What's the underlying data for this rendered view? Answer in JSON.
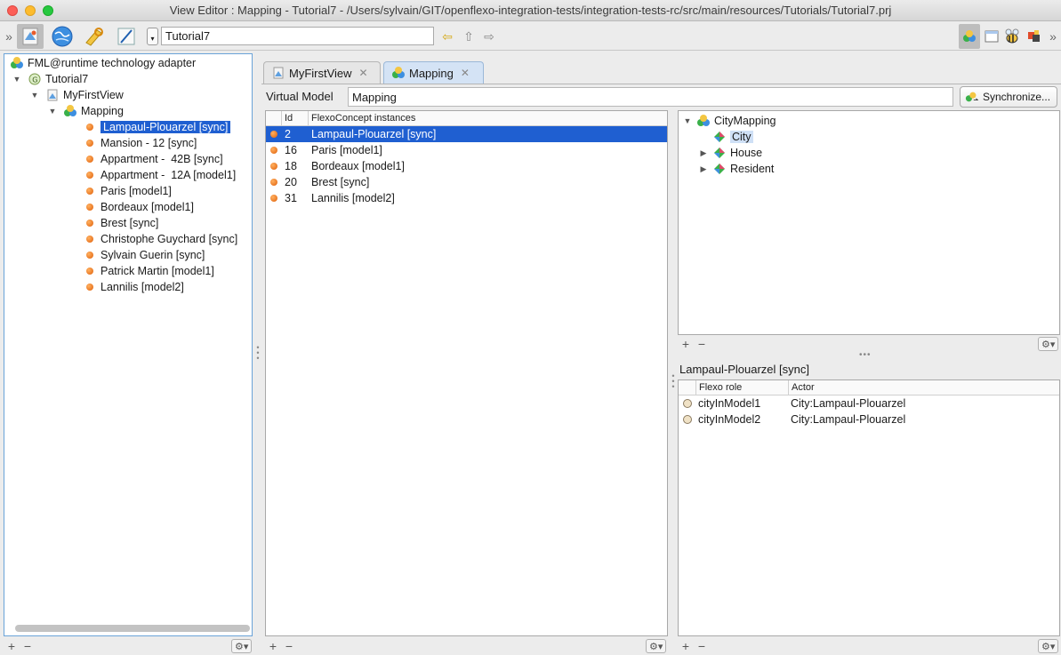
{
  "window": {
    "title": "View Editor : Mapping - Tutorial7 - /Users/sylvain/GIT/openflexo-integration-tests/integration-tests-rc/src/main/resources/Tutorials/Tutorial7.prj"
  },
  "toolbar": {
    "project_field": "Tutorial7",
    "icons": [
      "collapse-icon",
      "view-editor-icon",
      "globe-icon",
      "tools-icon",
      "pen-icon",
      "back-arrow-icon",
      "up-arrow-icon",
      "forward-arrow-icon",
      "modules-icon",
      "window-icon",
      "bee-icon",
      "flag-icon"
    ]
  },
  "left_tree": {
    "root": "FML@runtime technology adapter",
    "project": "Tutorial7",
    "view": "MyFirstView",
    "mapping": "Mapping",
    "instances": [
      "Lampaul-Plouarzel [sync]",
      "Mansion - 12 [sync]",
      "Appartment -  42B [sync]",
      "Appartment -  12A [model1]",
      "Paris [model1]",
      "Bordeaux [model1]",
      "Brest [sync]",
      "Christophe Guychard [sync]",
      "Sylvain Guerin [sync]",
      "Patrick Martin [model1]",
      "Lannilis [model2]"
    ],
    "selected_index": 0
  },
  "tabs": [
    {
      "label": "MyFirstView",
      "active": false
    },
    {
      "label": "Mapping",
      "active": true
    }
  ],
  "virtual_model": {
    "label": "Virtual Model",
    "value": "Mapping",
    "sync_button": "Synchronize..."
  },
  "instances_table": {
    "columns": [
      "Id",
      "FlexoConcept instances"
    ],
    "rows": [
      {
        "id": "2",
        "name": "Lampaul-Plouarzel [sync]",
        "selected": true
      },
      {
        "id": "16",
        "name": "Paris [model1]",
        "selected": false
      },
      {
        "id": "18",
        "name": "Bordeaux [model1]",
        "selected": false
      },
      {
        "id": "20",
        "name": "Brest [sync]",
        "selected": false
      },
      {
        "id": "31",
        "name": "Lannilis [model2]",
        "selected": false
      }
    ]
  },
  "concept_tree": {
    "root": "CityMapping",
    "children": [
      "City",
      "House",
      "Resident"
    ],
    "selected": "City"
  },
  "roles": {
    "title": "Lampaul-Plouarzel [sync]",
    "columns": [
      "Flexo role",
      "Actor"
    ],
    "rows": [
      {
        "role": "cityInModel1",
        "actor": "City:Lampaul-Plouarzel"
      },
      {
        "role": "cityInModel2",
        "actor": "City:Lampaul-Plouarzel"
      }
    ]
  },
  "colors": {
    "selection": "#1f5fd1",
    "active_tab": "#d4e3f5",
    "panel_border": "#6aa3d8"
  }
}
